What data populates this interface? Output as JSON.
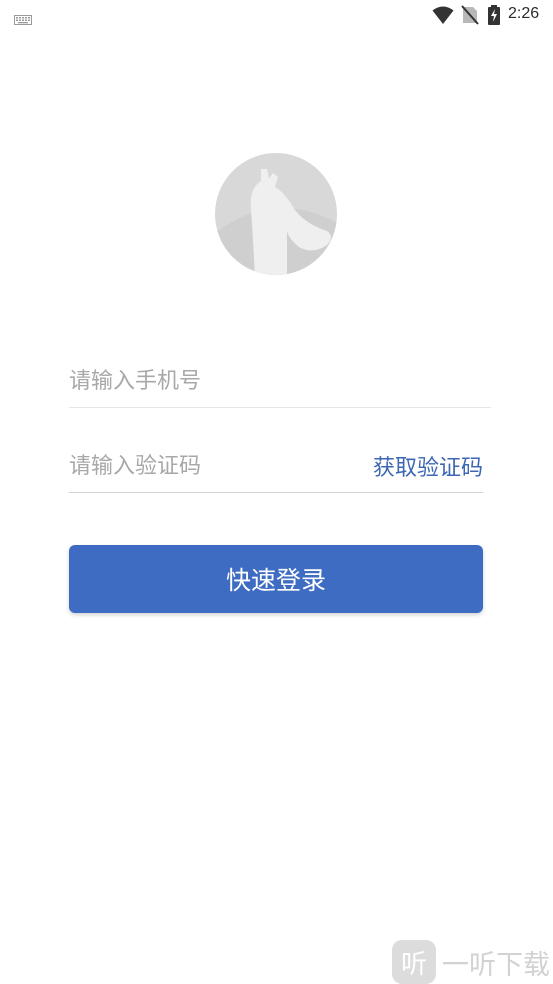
{
  "status_bar": {
    "time": "2:26",
    "icons": [
      "keyboard-icon",
      "wifi-icon",
      "no-sim-icon",
      "battery-charging-icon"
    ]
  },
  "avatar": {
    "icon": "giraffe-icon"
  },
  "phone_field": {
    "value": "",
    "placeholder": "请输入手机号"
  },
  "code_field": {
    "value": "",
    "placeholder": "请输入验证码",
    "get_code_label": "获取验证码"
  },
  "login_button": {
    "label": "快速登录"
  },
  "watermark": {
    "badge": "听",
    "text": "一听下载"
  },
  "colors": {
    "primary": "#3d6cc2",
    "link": "#3d66b4",
    "placeholder": "#a8a8a8",
    "divider": "#e6e6e6"
  }
}
